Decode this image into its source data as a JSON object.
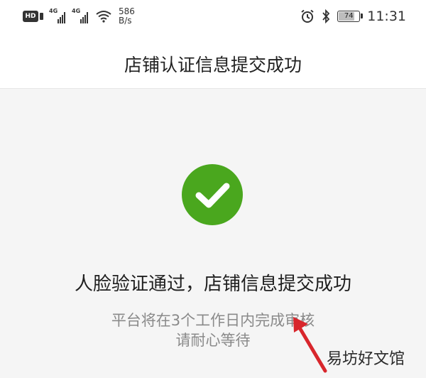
{
  "status_bar": {
    "hd_label": "HD",
    "net1_label": "4G",
    "net2_label": "4G",
    "speed_value": "586",
    "speed_unit": "B/s",
    "battery_level": "74",
    "time": "11:31",
    "icons": [
      "hd-icon",
      "signal-icon",
      "signal-icon",
      "wifi-icon",
      "alarm-icon",
      "bluetooth-icon",
      "battery-icon"
    ]
  },
  "nav": {
    "title": "店铺认证信息提交成功"
  },
  "result": {
    "icon": "check-circle-icon",
    "title": "人脸验证通过，店铺信息提交成功",
    "desc_line1": "平台将在3个工作日内完成审核",
    "desc_line2": "请耐心等待"
  },
  "watermark": {
    "text": "易坊好文馆"
  },
  "colors": {
    "success": "#4aa71e",
    "annotation_arrow": "#d8262c",
    "background": "#f5f5f5"
  }
}
